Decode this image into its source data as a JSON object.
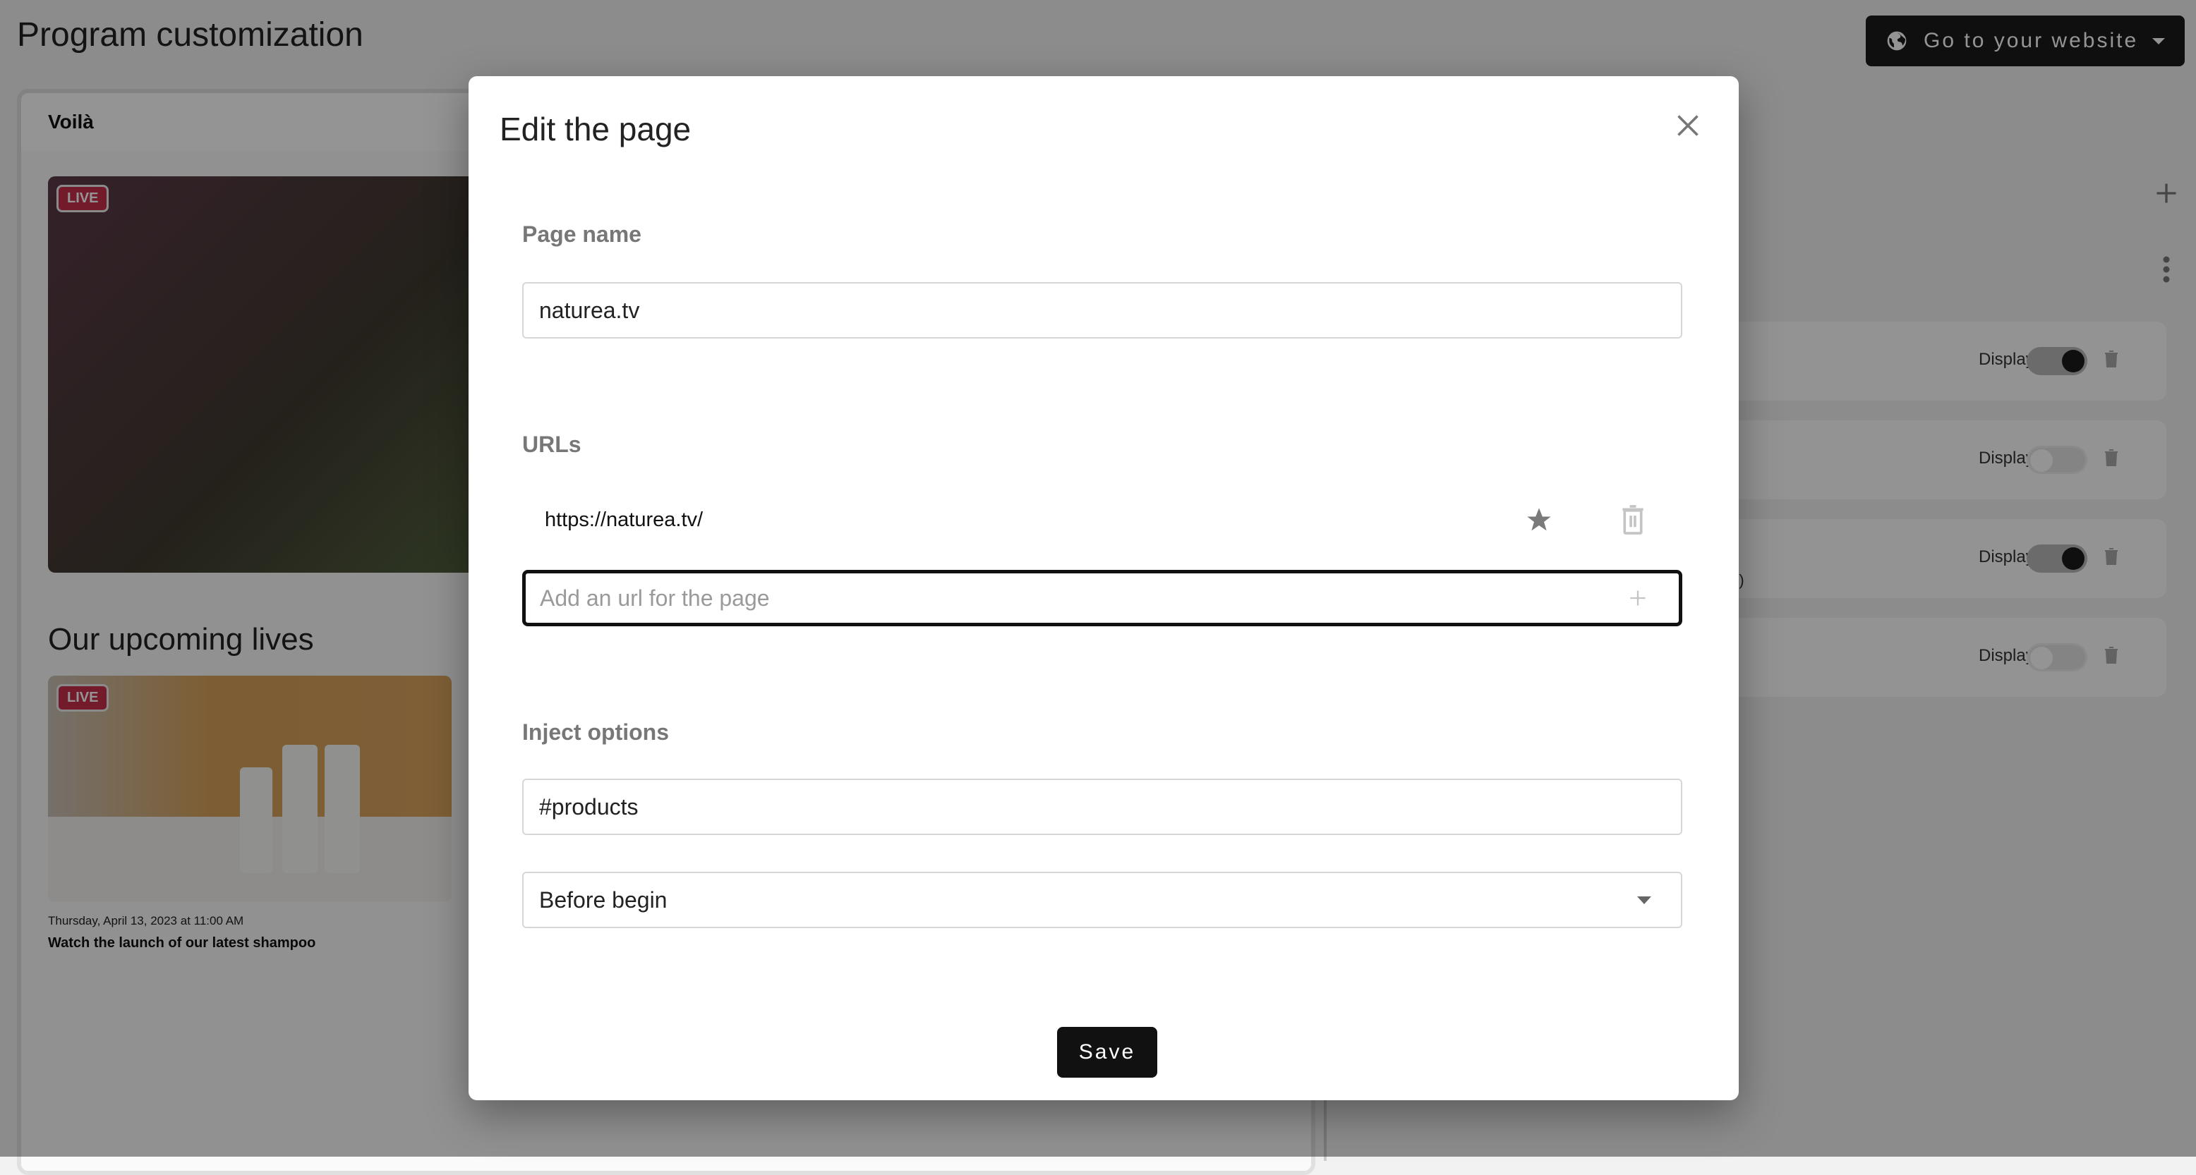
{
  "page": {
    "title": "Program customization",
    "website_button": {
      "label": "Go to your website",
      "icon": "globe-icon"
    }
  },
  "preview": {
    "header": "Voilà",
    "live_badge": "LIVE",
    "upcoming_title": "Our upcoming lives",
    "upcoming": [
      {
        "badge": "LIVE",
        "date": "Thursday, April 13, 2023 at 11:00 AM",
        "title": "Watch the launch of our latest shampoo"
      }
    ]
  },
  "right_panel": {
    "items": [
      {
        "label": "Display",
        "enabled": true,
        "subtext": ""
      },
      {
        "label": "Display",
        "enabled": false,
        "subtext": ""
      },
      {
        "label": "Display",
        "enabled": true,
        "subtext": "sion)"
      },
      {
        "label": "Display",
        "enabled": false,
        "subtext": ""
      }
    ]
  },
  "modal": {
    "title": "Edit the page",
    "page_name": {
      "label": "Page name",
      "value": "naturea.tv"
    },
    "urls": {
      "label": "URLs",
      "items": [
        {
          "url": "https://naturea.tv/",
          "favorite": true
        }
      ],
      "input_placeholder": "Add an url for the page",
      "input_value": ""
    },
    "inject": {
      "label": "Inject options",
      "selector_value": "#products",
      "position_value": "Before begin"
    },
    "save_label": "Save"
  },
  "colors": {
    "primary": "#111111",
    "live_badge": "#c9304a",
    "overlay": "rgba(0,0,0,0.42)"
  }
}
